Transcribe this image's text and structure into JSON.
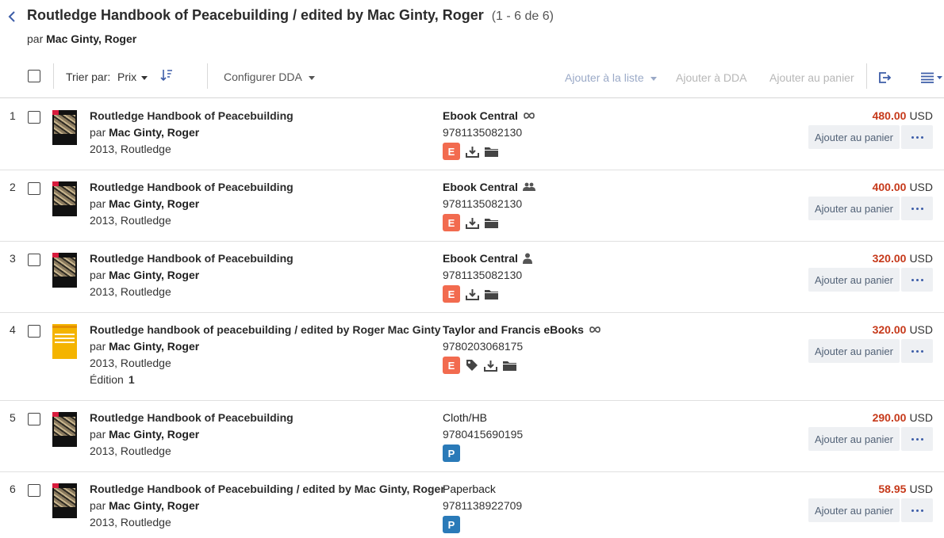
{
  "header": {
    "title": "Routledge Handbook of Peacebuilding / edited by Mac Ginty, Roger",
    "count": "(1 - 6 de 6)",
    "by_prefix": "par",
    "author": "Mac Ginty, Roger"
  },
  "toolbar": {
    "sort_label": "Trier par:",
    "sort_value": "Prix",
    "configure_dda": "Configurer DDA",
    "add_to_list": "Ajouter à la liste",
    "add_to_dda": "Ajouter à DDA",
    "add_to_cart": "Ajouter au panier"
  },
  "row_labels": {
    "by_prefix": "par",
    "add_to_cart": "Ajouter au panier",
    "edition_label": "Édition"
  },
  "rows": [
    {
      "num": "1",
      "title": "Routledge Handbook of Peacebuilding",
      "author": "Mac Ginty, Roger",
      "pub": "2013, Routledge",
      "format": "Ebook Central",
      "format_icon": "infinity-icon",
      "isbn": "9781135082130",
      "badge": "E",
      "extra_icons": [
        "download-icon",
        "folder-icon"
      ],
      "price": "480.00",
      "currency": "USD",
      "cover": "dark"
    },
    {
      "num": "2",
      "title": "Routledge Handbook of Peacebuilding",
      "author": "Mac Ginty, Roger",
      "pub": "2013, Routledge",
      "format": "Ebook Central",
      "format_icon": "users-icon",
      "isbn": "9781135082130",
      "badge": "E",
      "extra_icons": [
        "download-icon",
        "folder-icon"
      ],
      "price": "400.00",
      "currency": "USD",
      "cover": "dark"
    },
    {
      "num": "3",
      "title": "Routledge Handbook of Peacebuilding",
      "author": "Mac Ginty, Roger",
      "pub": "2013, Routledge",
      "format": "Ebook Central",
      "format_icon": "user-icon",
      "isbn": "9781135082130",
      "badge": "E",
      "extra_icons": [
        "download-icon",
        "folder-icon"
      ],
      "price": "320.00",
      "currency": "USD",
      "cover": "dark"
    },
    {
      "num": "4",
      "title": "Routledge handbook of peacebuilding / edited by Roger Mac Ginty",
      "author": "Mac Ginty, Roger",
      "pub": "2013, Routledge",
      "edition": "1",
      "format": "Taylor and Francis eBooks",
      "format_icon": "infinity-icon",
      "isbn": "9780203068175",
      "badge": "E",
      "extra_icons": [
        "tag-icon",
        "download-icon",
        "folder-icon"
      ],
      "price": "320.00",
      "currency": "USD",
      "cover": "yellow"
    },
    {
      "num": "5",
      "title": "Routledge Handbook of Peacebuilding",
      "author": "Mac Ginty, Roger",
      "pub": "2013, Routledge",
      "format": "Cloth/HB",
      "format_icon": "",
      "isbn": "9780415690195",
      "badge": "P",
      "extra_icons": [],
      "price": "290.00",
      "currency": "USD",
      "cover": "dark"
    },
    {
      "num": "6",
      "title": "Routledge Handbook of Peacebuilding / edited by Mac Ginty, Roger",
      "author": "Mac Ginty, Roger",
      "pub": "2013, Routledge",
      "format": "Paperback",
      "format_icon": "",
      "isbn": "9781138922709",
      "badge": "P",
      "extra_icons": [],
      "price": "58.95",
      "currency": "USD",
      "cover": "dark"
    }
  ],
  "colors": {
    "price": "#c6391a",
    "badge_e": "#f26b4f",
    "badge_p": "#2a7ab8",
    "link_disabled": "#9aa9c7",
    "more_dots": "#3d5da8"
  }
}
